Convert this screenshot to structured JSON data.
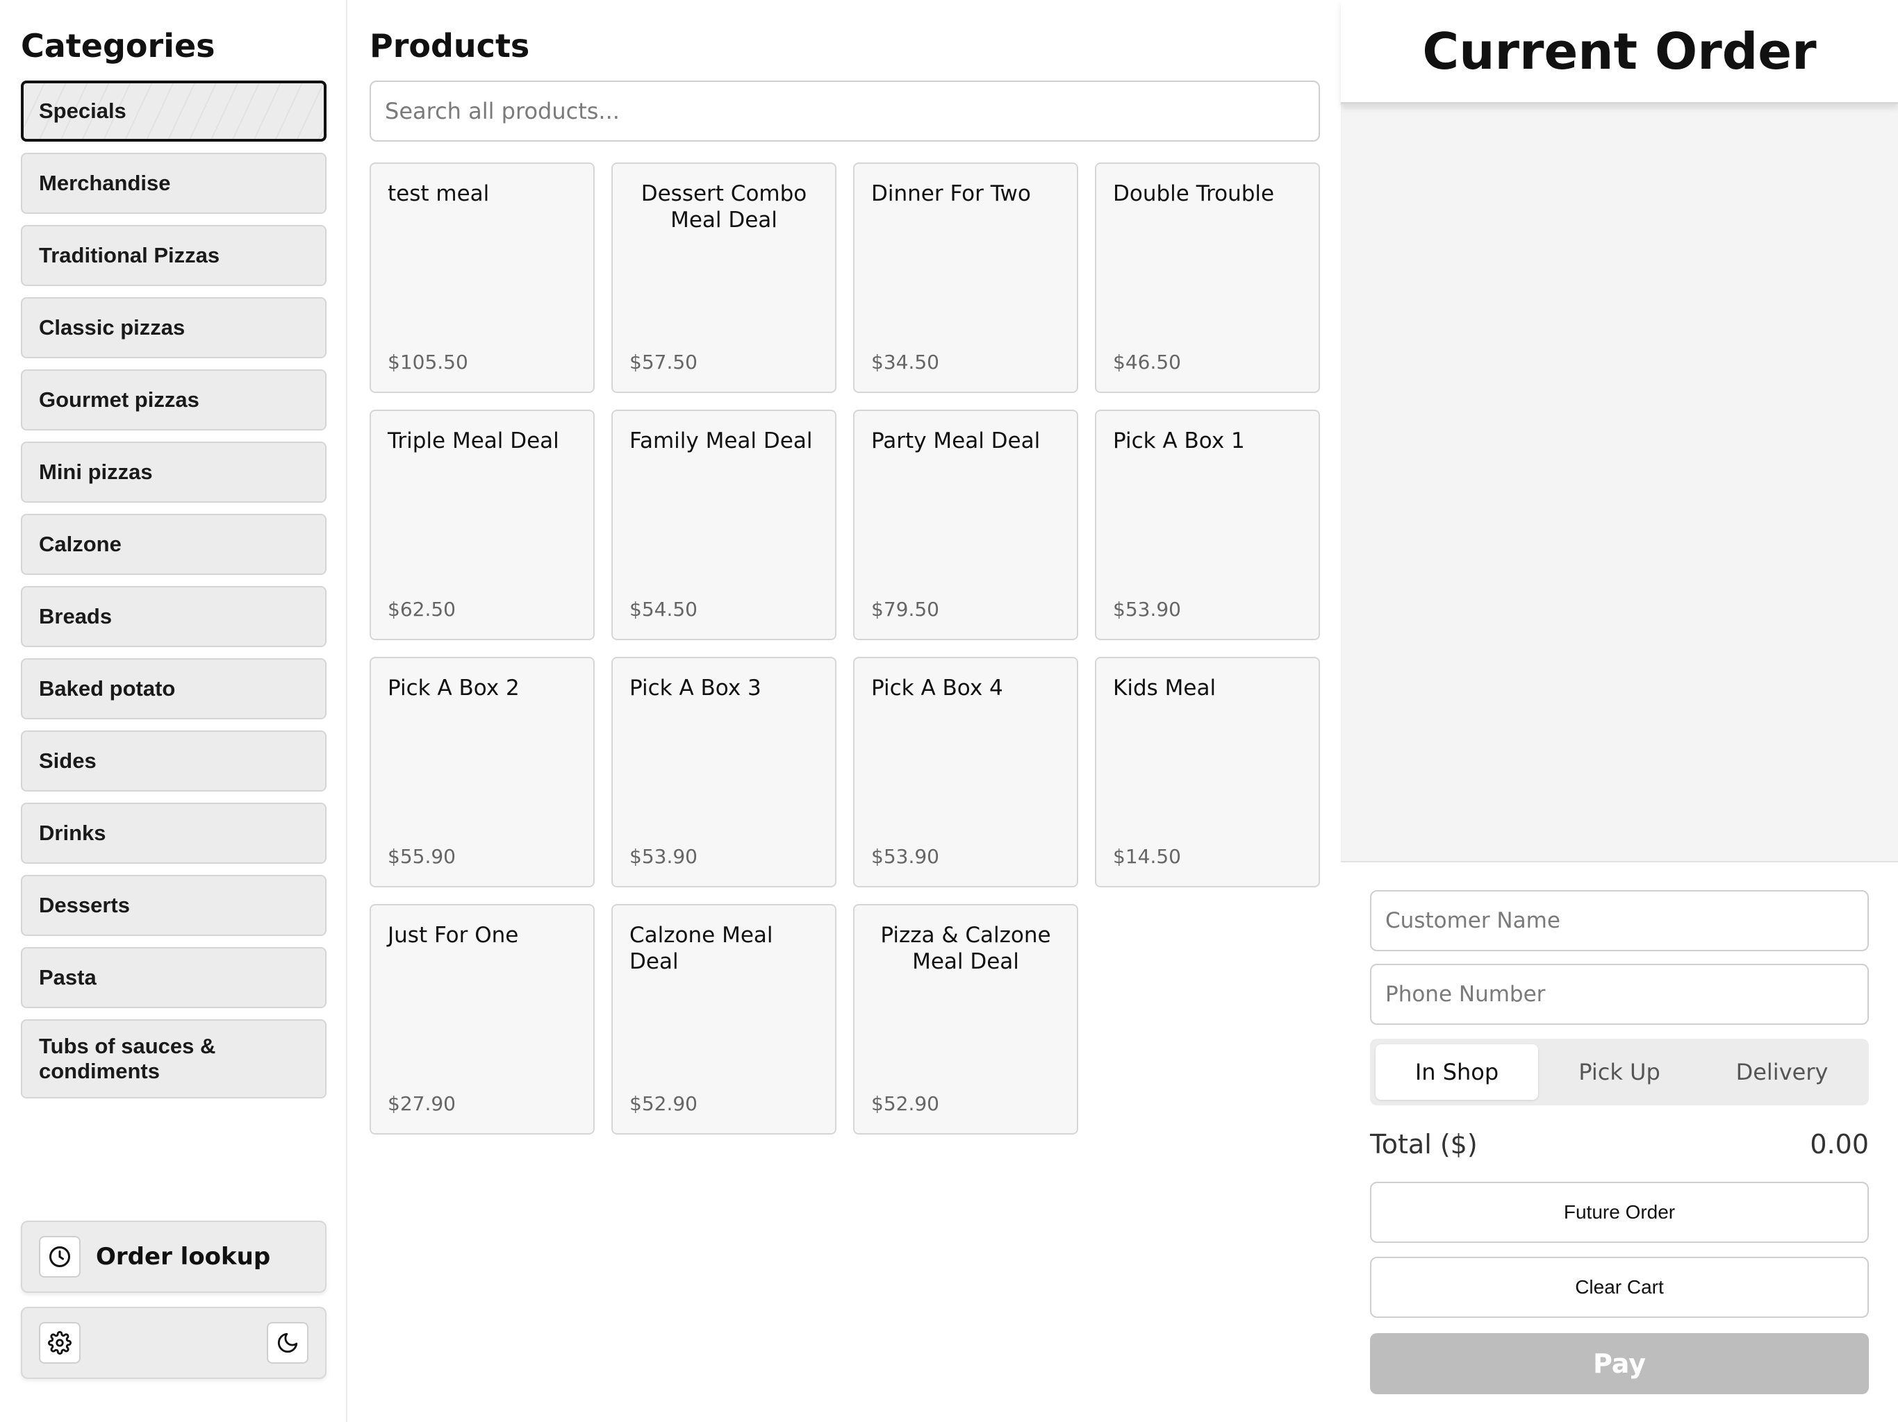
{
  "sidebar": {
    "title": "Categories",
    "categories": [
      "Specials",
      "Merchandise",
      "Traditional Pizzas",
      "Classic pizzas",
      "Gourmet pizzas",
      "Mini pizzas",
      "Calzone",
      "Breads",
      "Baked potato",
      "Sides",
      "Drinks",
      "Desserts",
      "Pasta",
      "Tubs of sauces & condiments"
    ],
    "active_category": "Specials",
    "order_lookup_label": "Order lookup",
    "icons": {
      "lookup": "clock-icon",
      "settings": "gear-icon",
      "theme": "moon-icon"
    }
  },
  "products": {
    "title": "Products",
    "search_placeholder": "Search all products...",
    "items": [
      {
        "name": "test meal",
        "price": "$105.50"
      },
      {
        "name": "Dessert Combo Meal Deal",
        "price": "$57.50"
      },
      {
        "name": "Dinner For Two",
        "price": "$34.50"
      },
      {
        "name": "Double Trouble",
        "price": "$46.50"
      },
      {
        "name": "Triple Meal Deal",
        "price": "$62.50"
      },
      {
        "name": "Family Meal Deal",
        "price": "$54.50"
      },
      {
        "name": "Party Meal Deal",
        "price": "$79.50"
      },
      {
        "name": "Pick A Box 1",
        "price": "$53.90"
      },
      {
        "name": "Pick A Box 2",
        "price": "$55.90"
      },
      {
        "name": "Pick A Box 3",
        "price": "$53.90"
      },
      {
        "name": "Pick A Box 4",
        "price": "$53.90"
      },
      {
        "name": "Kids Meal",
        "price": "$14.50"
      },
      {
        "name": "Just For One",
        "price": "$27.90"
      },
      {
        "name": "Calzone Meal Deal",
        "price": "$52.90"
      },
      {
        "name": "Pizza & Calzone Meal Deal",
        "price": "$52.90"
      }
    ]
  },
  "order": {
    "title": "Current Order",
    "customer_name_placeholder": "Customer Name",
    "phone_placeholder": "Phone Number",
    "order_types": [
      "In Shop",
      "Pick Up",
      "Delivery"
    ],
    "active_order_type": "In Shop",
    "total_label": "Total ($)",
    "total_value": "0.00",
    "future_order_label": "Future Order",
    "clear_cart_label": "Clear Cart",
    "pay_label": "Pay"
  },
  "colors": {
    "pay_disabled": "#bdbdbd",
    "category_bg": "#ececec",
    "card_bg": "#f7f7f7"
  }
}
